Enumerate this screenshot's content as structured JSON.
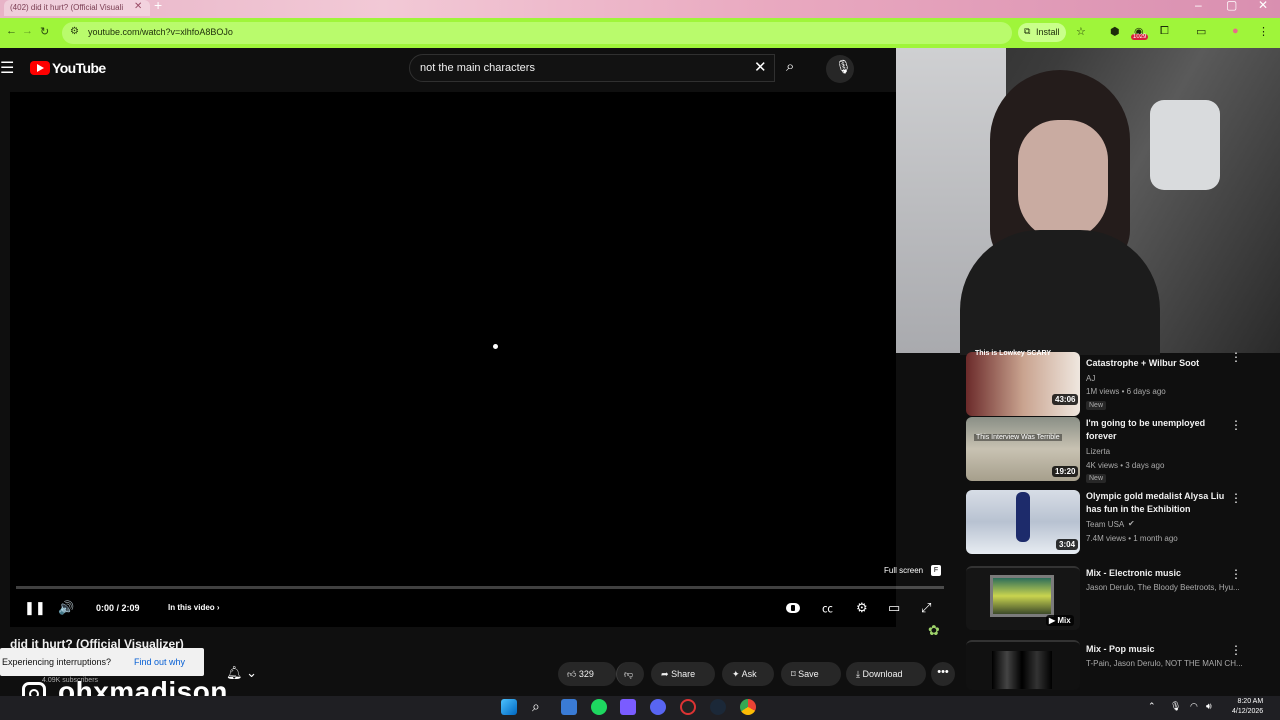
{
  "browser": {
    "tab_title": "(402) did it hurt? (Official Visuali",
    "url": "youtube.com/watch?v=xlhfoA8BOJo",
    "install_label": "Install",
    "ext_badge": "1029"
  },
  "youtube": {
    "logo_text": "YouTube",
    "search_value": "not the main characters"
  },
  "player": {
    "fullscreen_label": "Full screen",
    "fullscreen_key": "F",
    "time": "0:00 / 2:09",
    "in_this_video": "In this video",
    "progress": 0.0
  },
  "video": {
    "title": "did it hurt? (Official Visualizer)",
    "subscribers": "4.09K subscribers",
    "interrupt_text": "Experiencing interruptions?",
    "find_out": "Find out why",
    "likes": "329",
    "share": "Share",
    "ask": "Ask",
    "save": "Save",
    "download": "Download"
  },
  "watermark": "ohxmadison",
  "recs": [
    {
      "thumb_text": "This is Lowkey SCARY",
      "title": "Catastrophe + Wilbur Soot",
      "channel": "AJ",
      "meta": "1M views • 6 days ago",
      "badge": "New",
      "duration": "43:06"
    },
    {
      "thumb_text": "This Interview Was Terrible",
      "title": "I'm going to be unemployed forever",
      "channel": "Lizerta",
      "meta": "4K views • 3 days ago",
      "badge": "New",
      "duration": "19:20"
    },
    {
      "title": "Olympic gold medalist Alysa Liu has fun in the Exhibition",
      "channel": "Team USA",
      "meta": "7.4M views • 1 month ago",
      "duration": "3:04"
    },
    {
      "title": "Mix - Electronic music",
      "channel": "Jason Derulo, The Bloody Beetroots, Hyu...",
      "duration": "Mix"
    },
    {
      "title": "Mix - Pop music",
      "channel": "T-Pain, Jason Derulo, NOT THE MAIN CH..."
    }
  ],
  "taskbar": {
    "time": "8:20 AM",
    "date": "4/12/2026"
  }
}
